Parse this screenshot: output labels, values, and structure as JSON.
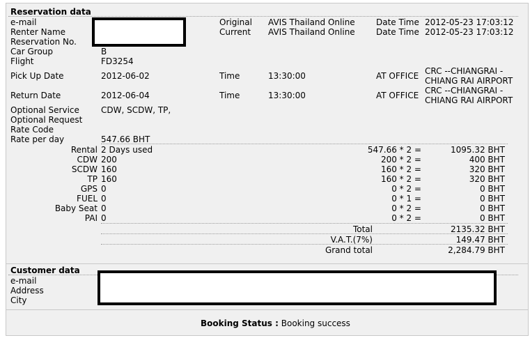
{
  "reservation": {
    "title": "Reservation data",
    "labels": {
      "email": "e-mail",
      "renter_name": "Renter Name",
      "reservation_no": "Reservation No.",
      "car_group": "Car Group",
      "flight": "Flight",
      "pick_up_date": "Pick Up Date",
      "return_date": "Return Date",
      "optional_service": "Optional Service",
      "optional_request": "Optional Request",
      "rate_code": "Rate Code",
      "rate_per_day": "Rate per day",
      "original": "Original",
      "current": "Current",
      "date_time": "Date Time",
      "time": "Time",
      "at_office": "AT OFFICE"
    },
    "original_source": "AVIS Thailand Online",
    "current_source": "AVIS Thailand Online",
    "original_datetime": "2012-05-23 17:03:12",
    "current_datetime": "2012-05-23 17:03:12",
    "car_group": "B",
    "flight": "FD3254",
    "pick_up": {
      "date": "2012-06-02",
      "time": "13:30:00",
      "office_line1": "CRC --CHIANGRAI -",
      "office_line2": "CHIANG RAI AIRPORT"
    },
    "return": {
      "date": "2012-06-04",
      "time": "13:30:00",
      "office_line1": "CRC --CHIANGRAI -",
      "office_line2": "CHIANG RAI AIRPORT"
    },
    "optional_service": "CDW, SCDW, TP,",
    "rate_per_day": "547.66 BHT"
  },
  "charges": [
    {
      "label": "Rental",
      "detail": "2 Days used",
      "calc": "547.66 * 2 =",
      "amount": "1095.32 BHT"
    },
    {
      "label": "CDW",
      "detail": "200",
      "calc": "200 * 2 =",
      "amount": "400 BHT"
    },
    {
      "label": "SCDW",
      "detail": "160",
      "calc": "160 * 2 =",
      "amount": "320 BHT"
    },
    {
      "label": "TP",
      "detail": "160",
      "calc": "160 * 2 =",
      "amount": "320 BHT"
    },
    {
      "label": "GPS",
      "detail": "0",
      "calc": "0 * 2 =",
      "amount": "0 BHT"
    },
    {
      "label": "FUEL",
      "detail": "0",
      "calc": "0 * 1 =",
      "amount": "0 BHT"
    },
    {
      "label": "Baby Seat",
      "detail": "0",
      "calc": "0 * 2 =",
      "amount": "0 BHT"
    },
    {
      "label": "PAI",
      "detail": "0",
      "calc": "0 * 2 =",
      "amount": "0 BHT"
    }
  ],
  "totals": {
    "total_label": "Total",
    "total": "2135.32 BHT",
    "vat_label": "V.A.T.(7%)",
    "vat": "149.47 BHT",
    "grand_label": "Grand total",
    "grand": "2,284.79 BHT"
  },
  "customer": {
    "title": "Customer data",
    "labels": {
      "email": "e-mail",
      "address": "Address",
      "city": "City"
    }
  },
  "status": {
    "label": "Booking Status :",
    "value": "Booking success"
  }
}
